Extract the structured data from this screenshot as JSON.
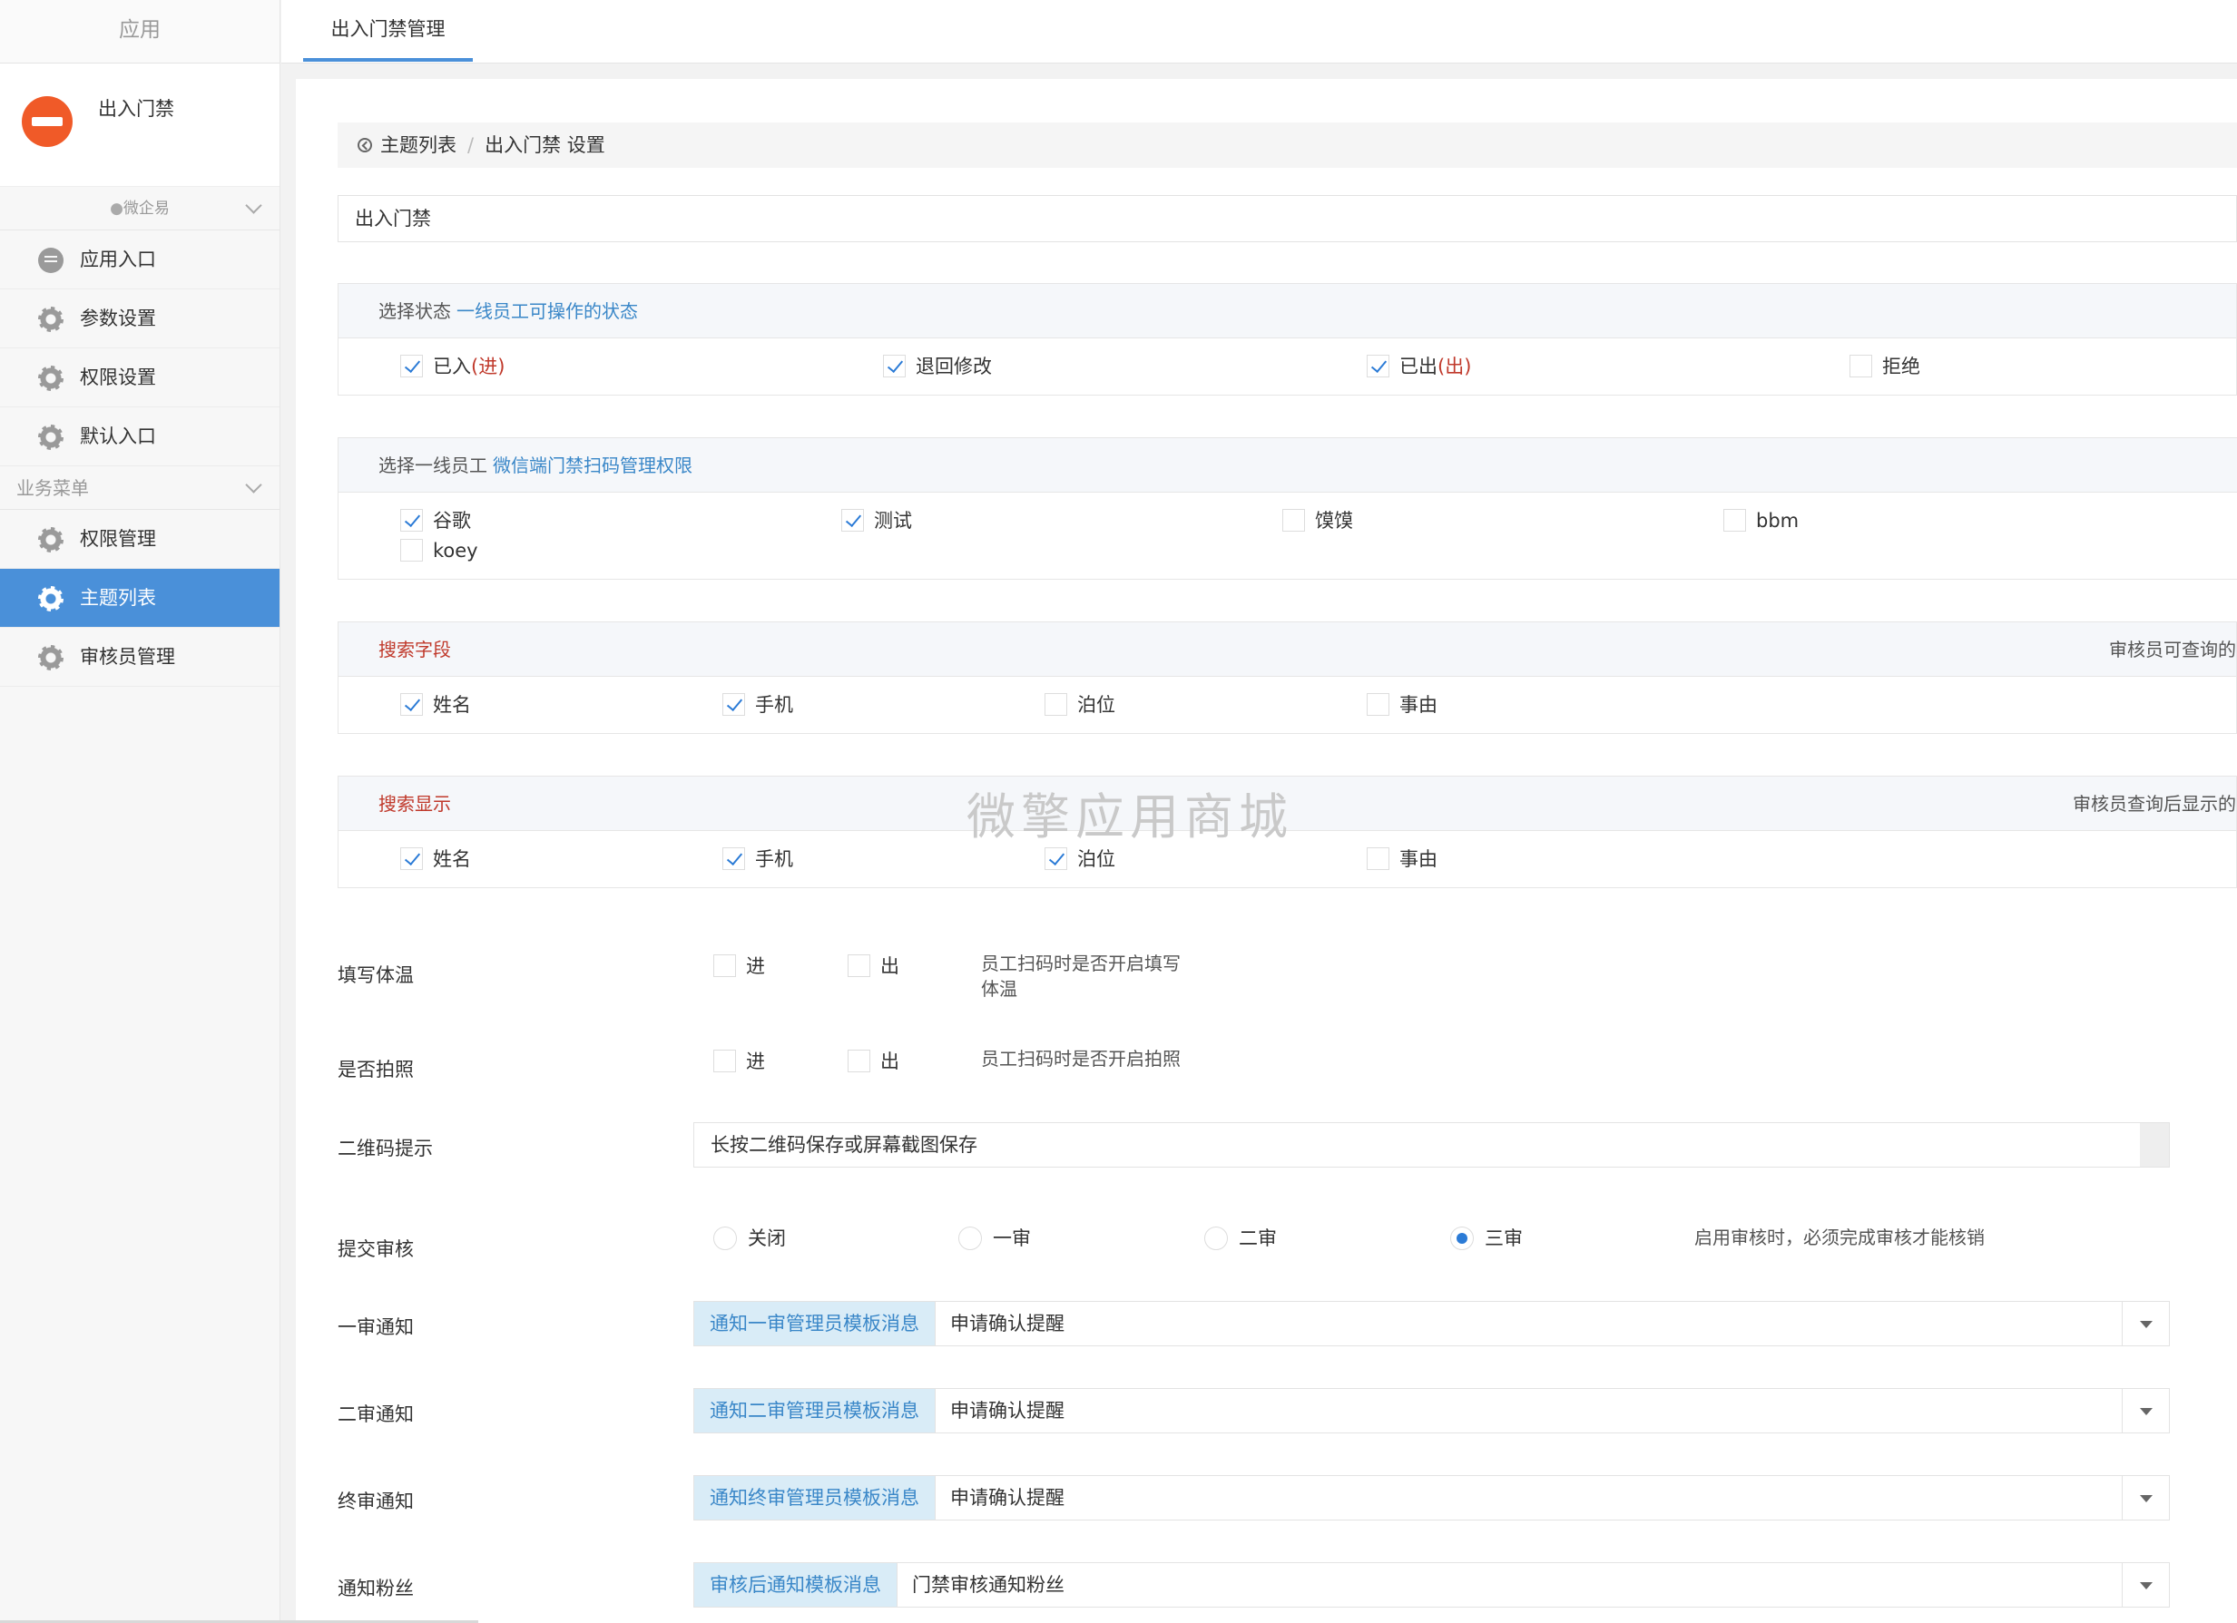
{
  "sidebar": {
    "header": "应用",
    "app_name": "出入门禁",
    "group_wechat": "微企易",
    "items_top": [
      {
        "label": "应用入口",
        "icon": "chat-bubble-icon"
      },
      {
        "label": "参数设置",
        "icon": "gear-icon"
      },
      {
        "label": "权限设置",
        "icon": "gear-icon"
      },
      {
        "label": "默认入口",
        "icon": "gear-icon"
      }
    ],
    "group_business": "业务菜单",
    "items_business": [
      {
        "label": "权限管理",
        "icon": "gear-icon"
      },
      {
        "label": "主题列表",
        "icon": "gear-icon",
        "active": true
      },
      {
        "label": "审核员管理",
        "icon": "gear-icon"
      }
    ]
  },
  "tab": {
    "label": "出入门禁管理"
  },
  "breadcrumb": {
    "back": "主题列表",
    "sep": "/",
    "current": "出入门禁 设置"
  },
  "topic_name": "出入门禁",
  "status_section": {
    "title": "选择状态",
    "subtitle": "一线员工可操作的状态",
    "options": [
      {
        "label": "已入",
        "suffix": "(进)",
        "checked": true
      },
      {
        "label": "退回修改",
        "suffix": "",
        "checked": true
      },
      {
        "label": "已出",
        "suffix": "(出)",
        "checked": true
      },
      {
        "label": "拒绝",
        "suffix": "",
        "checked": false
      }
    ]
  },
  "staff_section": {
    "title": "选择一线员工",
    "subtitle": "微信端门禁扫码管理权限",
    "options": [
      {
        "label": "谷歌",
        "checked": true
      },
      {
        "label": "测试",
        "checked": true
      },
      {
        "label": "馍馍",
        "checked": false
      },
      {
        "label": "bbm",
        "checked": false
      },
      {
        "label": "koey",
        "checked": false
      }
    ]
  },
  "search_field_section": {
    "title": "搜索字段",
    "right": "审核员可查询的",
    "options": [
      {
        "label": "姓名",
        "checked": true
      },
      {
        "label": "手机",
        "checked": true
      },
      {
        "label": "泊位",
        "checked": false
      },
      {
        "label": "事由",
        "checked": false
      }
    ]
  },
  "search_display_section": {
    "title": "搜索显示",
    "right": "审核员查询后显示的",
    "options": [
      {
        "label": "姓名",
        "checked": true
      },
      {
        "label": "手机",
        "checked": true
      },
      {
        "label": "泊位",
        "checked": true
      },
      {
        "label": "事由",
        "checked": false
      }
    ]
  },
  "watermark": "微擎应用商城",
  "temperature": {
    "label": "填写体温",
    "in": "进",
    "out": "出",
    "hint_line1": "员工扫码时是否开启填写",
    "hint_line2": "体温"
  },
  "photo": {
    "label": "是否拍照",
    "in": "进",
    "out": "出",
    "hint": "员工扫码时是否开启拍照"
  },
  "qrcode": {
    "label": "二维码提示",
    "value": "长按二维码保存或屏幕截图保存"
  },
  "review": {
    "label": "提交审核",
    "options": [
      "关闭",
      "一审",
      "二审",
      "三审"
    ],
    "selected": "三审",
    "hint": "启用审核时，必须完成审核才能核销"
  },
  "notifications": [
    {
      "label": "一审通知",
      "addon": "通知一审管理员模板消息",
      "value": "申请确认提醒"
    },
    {
      "label": "二审通知",
      "addon": "通知二审管理员模板消息",
      "value": "申请确认提醒"
    },
    {
      "label": "终审通知",
      "addon": "通知终审管理员模板消息",
      "value": "申请确认提醒"
    },
    {
      "label": "通知粉丝",
      "addon": "审核后通知模板消息",
      "value": "门禁审核通知粉丝"
    }
  ],
  "colors": {
    "accent": "#4a90d9",
    "link": "#3a87c8",
    "red": "#c0392b",
    "addon_bg": "#d9ecf7"
  }
}
